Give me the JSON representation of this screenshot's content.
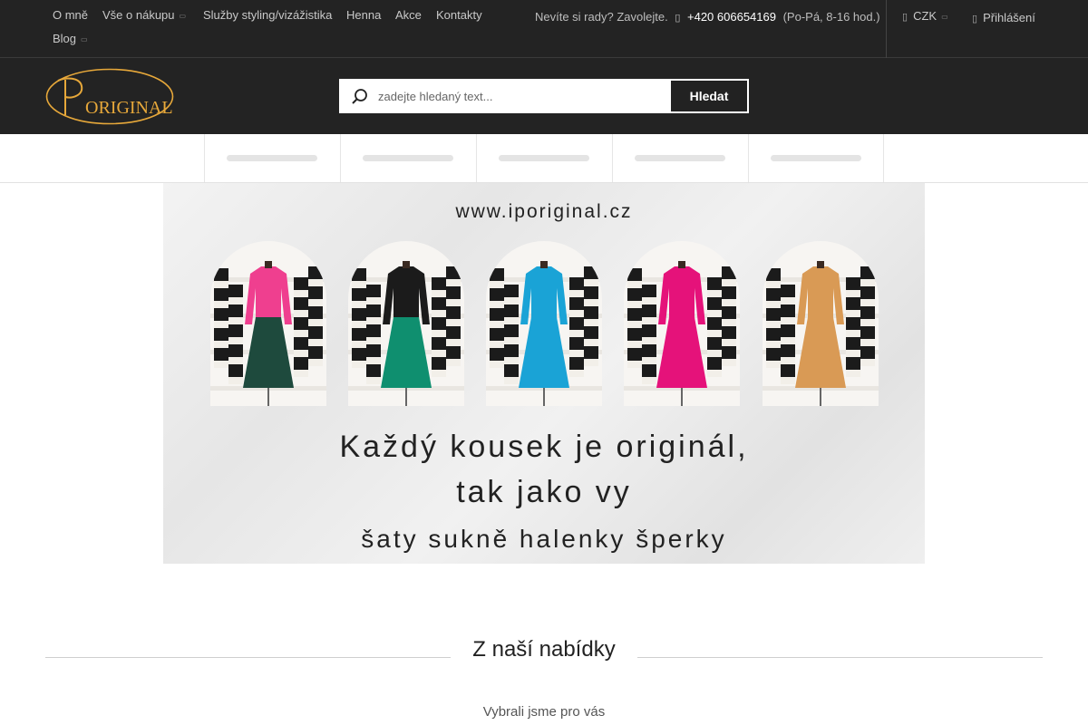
{
  "topbar": {
    "nav": [
      {
        "label": "O mně",
        "dropdown": false
      },
      {
        "label": "Vše o nákupu",
        "dropdown": true
      },
      {
        "label": "Služby styling/vizážistika",
        "dropdown": false
      },
      {
        "label": "Henna",
        "dropdown": false
      },
      {
        "label": "Akce",
        "dropdown": false
      },
      {
        "label": "Kontakty",
        "dropdown": false
      },
      {
        "label": "Blog",
        "dropdown": true
      }
    ],
    "contact_text": "Nevíte si rady? Zavolejte.",
    "phone": "+420 606654169",
    "hours": "(Po-Pá, 8-16 hod.)",
    "currency": "CZK",
    "login": "Přihlášení",
    "icons": {
      "phone": "phone-icon",
      "currency": "wallet-icon",
      "login": "user-icon"
    }
  },
  "header": {
    "logo_text": "ORIGINAL",
    "search_placeholder": "zadejte hledaný text...",
    "search_value": "",
    "search_button": "Hledat"
  },
  "menu_placeholders": 5,
  "banner": {
    "url": "www.iporiginal.cz",
    "line1": "Každý kousek je originál,",
    "line2": "tak jako vy",
    "line3": "šaty   sukně   halenky   šperky",
    "dresses": [
      {
        "top": "#ef3f8f",
        "bottom": "#1e4a3d"
      },
      {
        "top": "#1b1b1b",
        "bottom": "#0f8f6f"
      },
      {
        "top": "#1aa3d6",
        "bottom": "#1aa3d6"
      },
      {
        "top": "#e5127a",
        "bottom": "#e5127a"
      },
      {
        "top": "#d99a55",
        "bottom": "#d99a55"
      }
    ]
  },
  "section": {
    "title": "Z naší nabídky",
    "subtitle": "Vybrali jsme pro vás"
  },
  "colors": {
    "dark": "#232323",
    "accent": "#e7a83a"
  }
}
